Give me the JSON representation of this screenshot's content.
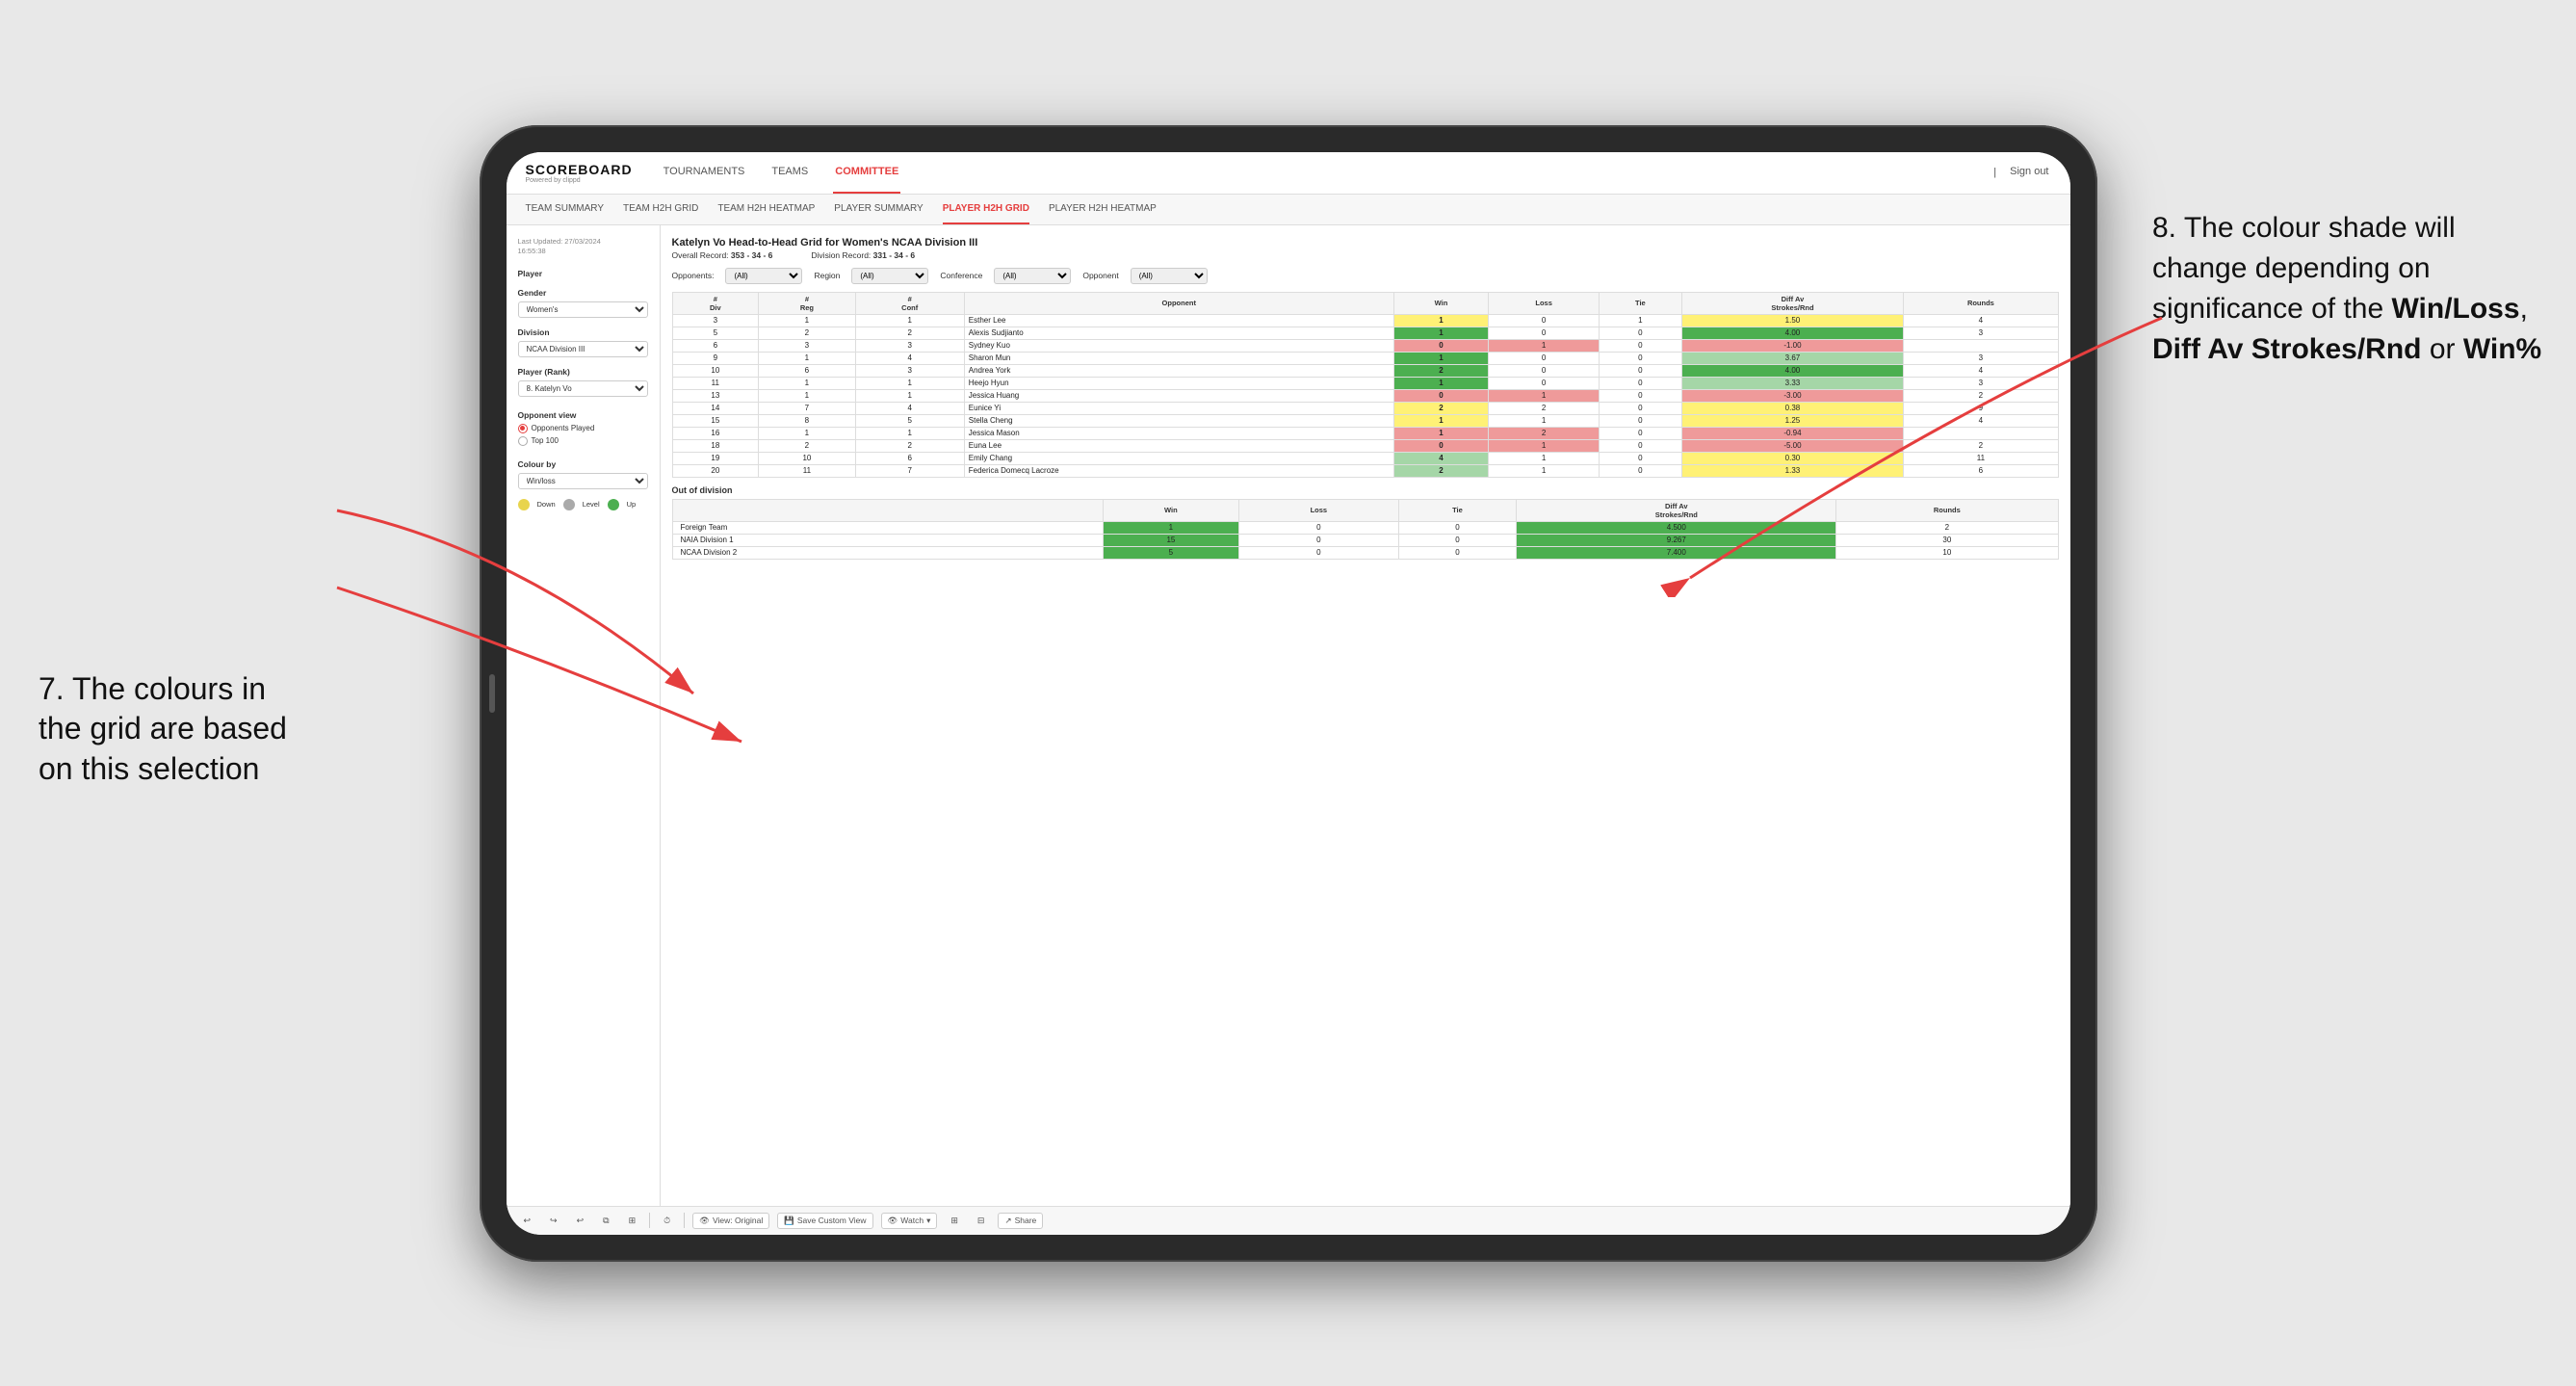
{
  "annotations": {
    "left": {
      "line1": "7. The colours in",
      "line2": "the grid are based",
      "line3": "on this selection"
    },
    "right": {
      "intro": "8. The colour shade will change depending on significance of the ",
      "bold1": "Win/Loss",
      "sep1": ", ",
      "bold2": "Diff Av Strokes/Rnd",
      "sep2": " or ",
      "bold3": "Win%"
    }
  },
  "header": {
    "logo": "SCOREBOARD",
    "logo_sub": "Powered by clippd",
    "nav": [
      "TOURNAMENTS",
      "TEAMS",
      "COMMITTEE"
    ],
    "active_nav": "COMMITTEE",
    "sign_out": "Sign out"
  },
  "sub_nav": {
    "items": [
      "TEAM SUMMARY",
      "TEAM H2H GRID",
      "TEAM H2H HEATMAP",
      "PLAYER SUMMARY",
      "PLAYER H2H GRID",
      "PLAYER H2H HEATMAP"
    ],
    "active": "PLAYER H2H GRID"
  },
  "sidebar": {
    "last_updated": "Last Updated: 27/03/2024\n16:55:38",
    "player_label": "Player",
    "gender_label": "Gender",
    "gender_value": "Women's",
    "division_label": "Division",
    "division_value": "NCAA Division III",
    "player_rank_label": "Player (Rank)",
    "player_rank_value": "8. Katelyn Vo",
    "opponent_view_label": "Opponent view",
    "opponent_view_options": [
      "Opponents Played",
      "Top 100"
    ],
    "opponent_view_selected": "Opponents Played",
    "colour_by_label": "Colour by",
    "colour_by_value": "Win/loss",
    "colour_legend": [
      {
        "color": "#e8d44d",
        "label": "Down"
      },
      {
        "color": "#aaaaaa",
        "label": "Level"
      },
      {
        "color": "#4caf50",
        "label": "Up"
      }
    ]
  },
  "grid": {
    "title": "Katelyn Vo Head-to-Head Grid for Women's NCAA Division III",
    "overall_record_label": "Overall Record:",
    "overall_record": "353 - 34 - 6",
    "division_record_label": "Division Record:",
    "division_record": "331 - 34 - 6",
    "filters": {
      "opponents_label": "Opponents:",
      "opponents_value": "(All)",
      "region_label": "Region",
      "region_value": "(All)",
      "conference_label": "Conference",
      "conference_value": "(All)",
      "opponent_label": "Opponent",
      "opponent_value": "(All)"
    },
    "table_headers": [
      "#\nDiv",
      "#\nReg",
      "#\nConf",
      "Opponent",
      "Win",
      "Loss",
      "Tie",
      "Diff Av\nStrokes/Rnd",
      "Rounds"
    ],
    "rows": [
      {
        "div": "3",
        "reg": "1",
        "conf": "1",
        "opponent": "Esther Lee",
        "win": "1",
        "loss": "0",
        "tie": "1",
        "diff": "1.50",
        "rounds": "4",
        "win_color": "yellow",
        "diff_color": "yellow"
      },
      {
        "div": "5",
        "reg": "2",
        "conf": "2",
        "opponent": "Alexis Sudjianto",
        "win": "1",
        "loss": "0",
        "tie": "0",
        "diff": "4.00",
        "rounds": "3",
        "win_color": "green-dark",
        "diff_color": "green-dark"
      },
      {
        "div": "6",
        "reg": "3",
        "conf": "3",
        "opponent": "Sydney Kuo",
        "win": "0",
        "loss": "1",
        "tie": "0",
        "diff": "-1.00",
        "rounds": "",
        "win_color": "red-light",
        "diff_color": "red-light"
      },
      {
        "div": "9",
        "reg": "1",
        "conf": "4",
        "opponent": "Sharon Mun",
        "win": "1",
        "loss": "0",
        "tie": "0",
        "diff": "3.67",
        "rounds": "3",
        "win_color": "green-dark",
        "diff_color": "green-light"
      },
      {
        "div": "10",
        "reg": "6",
        "conf": "3",
        "opponent": "Andrea York",
        "win": "2",
        "loss": "0",
        "tie": "0",
        "diff": "4.00",
        "rounds": "4",
        "win_color": "green-dark",
        "diff_color": "green-dark"
      },
      {
        "div": "11",
        "reg": "1",
        "conf": "1",
        "opponent": "Heejo Hyun",
        "win": "1",
        "loss": "0",
        "tie": "0",
        "diff": "3.33",
        "rounds": "3",
        "win_color": "green-dark",
        "diff_color": "green-light"
      },
      {
        "div": "13",
        "reg": "1",
        "conf": "1",
        "opponent": "Jessica Huang",
        "win": "0",
        "loss": "1",
        "tie": "0",
        "diff": "-3.00",
        "rounds": "2",
        "win_color": "red-light",
        "diff_color": "red-light"
      },
      {
        "div": "14",
        "reg": "7",
        "conf": "4",
        "opponent": "Eunice Yi",
        "win": "2",
        "loss": "2",
        "tie": "0",
        "diff": "0.38",
        "rounds": "9",
        "win_color": "yellow",
        "diff_color": "yellow"
      },
      {
        "div": "15",
        "reg": "8",
        "conf": "5",
        "opponent": "Stella Cheng",
        "win": "1",
        "loss": "1",
        "tie": "0",
        "diff": "1.25",
        "rounds": "4",
        "win_color": "yellow",
        "diff_color": "yellow"
      },
      {
        "div": "16",
        "reg": "1",
        "conf": "1",
        "opponent": "Jessica Mason",
        "win": "1",
        "loss": "2",
        "tie": "0",
        "diff": "-0.94",
        "rounds": "",
        "win_color": "red-light",
        "diff_color": "red-light"
      },
      {
        "div": "18",
        "reg": "2",
        "conf": "2",
        "opponent": "Euna Lee",
        "win": "0",
        "loss": "1",
        "tie": "0",
        "diff": "-5.00",
        "rounds": "2",
        "win_color": "red-light",
        "diff_color": "red-light"
      },
      {
        "div": "19",
        "reg": "10",
        "conf": "6",
        "opponent": "Emily Chang",
        "win": "4",
        "loss": "1",
        "tie": "0",
        "diff": "0.30",
        "rounds": "11",
        "win_color": "green-light",
        "diff_color": "yellow"
      },
      {
        "div": "20",
        "reg": "11",
        "conf": "7",
        "opponent": "Federica Domecq Lacroze",
        "win": "2",
        "loss": "1",
        "tie": "0",
        "diff": "1.33",
        "rounds": "6",
        "win_color": "green-light",
        "diff_color": "yellow"
      }
    ],
    "out_of_division_label": "Out of division",
    "out_rows": [
      {
        "opponent": "Foreign Team",
        "win": "1",
        "loss": "0",
        "tie": "0",
        "diff": "4.500",
        "rounds": "2",
        "win_color": "green-dark",
        "diff_color": "green-dark"
      },
      {
        "opponent": "NAIA Division 1",
        "win": "15",
        "loss": "0",
        "tie": "0",
        "diff": "9.267",
        "rounds": "30",
        "win_color": "green-dark",
        "diff_color": "green-dark"
      },
      {
        "opponent": "NCAA Division 2",
        "win": "5",
        "loss": "0",
        "tie": "0",
        "diff": "7.400",
        "rounds": "10",
        "win_color": "green-dark",
        "diff_color": "green-dark"
      }
    ]
  },
  "toolbar": {
    "view_original": "View: Original",
    "save_custom": "Save Custom View",
    "watch": "Watch",
    "share": "Share"
  }
}
